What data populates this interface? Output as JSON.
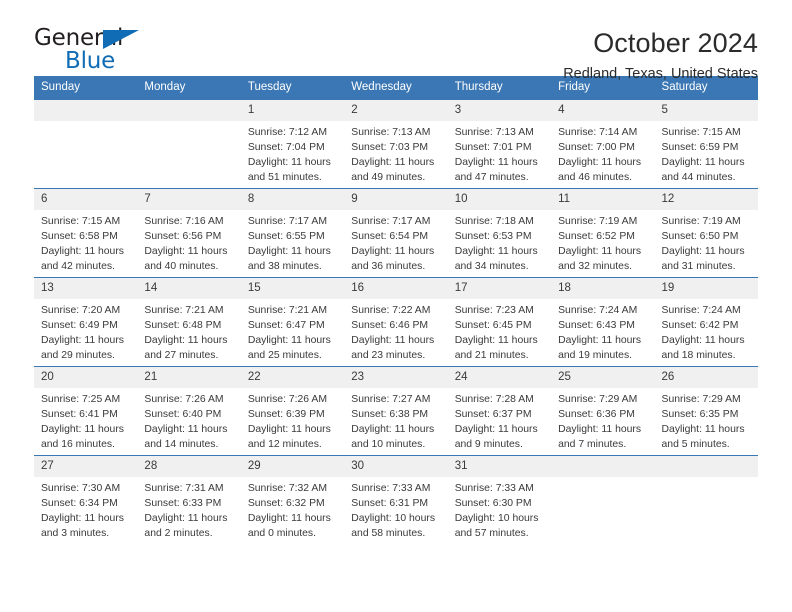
{
  "logo": {
    "word_one": "General",
    "word_two": "Blue",
    "triangle": "blue-triangle",
    "accent_dark": "#231f20",
    "accent_blue": "#0f6cb5"
  },
  "header": {
    "title": "October 2024",
    "subtitle": "Redland, Texas, United States"
  },
  "theme": {
    "header_blue": "#3b77b4",
    "daynum_band": "#f0f0f0",
    "text": "#3a3a3a"
  },
  "weekday_headers": [
    "Sunday",
    "Monday",
    "Tuesday",
    "Wednesday",
    "Thursday",
    "Friday",
    "Saturday"
  ],
  "weeks": [
    [
      {
        "day": "",
        "sunrise": "",
        "sunset": "",
        "daylight_line1": "",
        "daylight_line2": "",
        "empty": true
      },
      {
        "day": "",
        "sunrise": "",
        "sunset": "",
        "daylight_line1": "",
        "daylight_line2": "",
        "empty": true
      },
      {
        "day": "1",
        "sunrise": "Sunrise: 7:12 AM",
        "sunset": "Sunset: 7:04 PM",
        "daylight_line1": "Daylight: 11 hours",
        "daylight_line2": "and 51 minutes."
      },
      {
        "day": "2",
        "sunrise": "Sunrise: 7:13 AM",
        "sunset": "Sunset: 7:03 PM",
        "daylight_line1": "Daylight: 11 hours",
        "daylight_line2": "and 49 minutes."
      },
      {
        "day": "3",
        "sunrise": "Sunrise: 7:13 AM",
        "sunset": "Sunset: 7:01 PM",
        "daylight_line1": "Daylight: 11 hours",
        "daylight_line2": "and 47 minutes."
      },
      {
        "day": "4",
        "sunrise": "Sunrise: 7:14 AM",
        "sunset": "Sunset: 7:00 PM",
        "daylight_line1": "Daylight: 11 hours",
        "daylight_line2": "and 46 minutes."
      },
      {
        "day": "5",
        "sunrise": "Sunrise: 7:15 AM",
        "sunset": "Sunset: 6:59 PM",
        "daylight_line1": "Daylight: 11 hours",
        "daylight_line2": "and 44 minutes."
      }
    ],
    [
      {
        "day": "6",
        "sunrise": "Sunrise: 7:15 AM",
        "sunset": "Sunset: 6:58 PM",
        "daylight_line1": "Daylight: 11 hours",
        "daylight_line2": "and 42 minutes."
      },
      {
        "day": "7",
        "sunrise": "Sunrise: 7:16 AM",
        "sunset": "Sunset: 6:56 PM",
        "daylight_line1": "Daylight: 11 hours",
        "daylight_line2": "and 40 minutes."
      },
      {
        "day": "8",
        "sunrise": "Sunrise: 7:17 AM",
        "sunset": "Sunset: 6:55 PM",
        "daylight_line1": "Daylight: 11 hours",
        "daylight_line2": "and 38 minutes."
      },
      {
        "day": "9",
        "sunrise": "Sunrise: 7:17 AM",
        "sunset": "Sunset: 6:54 PM",
        "daylight_line1": "Daylight: 11 hours",
        "daylight_line2": "and 36 minutes."
      },
      {
        "day": "10",
        "sunrise": "Sunrise: 7:18 AM",
        "sunset": "Sunset: 6:53 PM",
        "daylight_line1": "Daylight: 11 hours",
        "daylight_line2": "and 34 minutes."
      },
      {
        "day": "11",
        "sunrise": "Sunrise: 7:19 AM",
        "sunset": "Sunset: 6:52 PM",
        "daylight_line1": "Daylight: 11 hours",
        "daylight_line2": "and 32 minutes."
      },
      {
        "day": "12",
        "sunrise": "Sunrise: 7:19 AM",
        "sunset": "Sunset: 6:50 PM",
        "daylight_line1": "Daylight: 11 hours",
        "daylight_line2": "and 31 minutes."
      }
    ],
    [
      {
        "day": "13",
        "sunrise": "Sunrise: 7:20 AM",
        "sunset": "Sunset: 6:49 PM",
        "daylight_line1": "Daylight: 11 hours",
        "daylight_line2": "and 29 minutes."
      },
      {
        "day": "14",
        "sunrise": "Sunrise: 7:21 AM",
        "sunset": "Sunset: 6:48 PM",
        "daylight_line1": "Daylight: 11 hours",
        "daylight_line2": "and 27 minutes."
      },
      {
        "day": "15",
        "sunrise": "Sunrise: 7:21 AM",
        "sunset": "Sunset: 6:47 PM",
        "daylight_line1": "Daylight: 11 hours",
        "daylight_line2": "and 25 minutes."
      },
      {
        "day": "16",
        "sunrise": "Sunrise: 7:22 AM",
        "sunset": "Sunset: 6:46 PM",
        "daylight_line1": "Daylight: 11 hours",
        "daylight_line2": "and 23 minutes."
      },
      {
        "day": "17",
        "sunrise": "Sunrise: 7:23 AM",
        "sunset": "Sunset: 6:45 PM",
        "daylight_line1": "Daylight: 11 hours",
        "daylight_line2": "and 21 minutes."
      },
      {
        "day": "18",
        "sunrise": "Sunrise: 7:24 AM",
        "sunset": "Sunset: 6:43 PM",
        "daylight_line1": "Daylight: 11 hours",
        "daylight_line2": "and 19 minutes."
      },
      {
        "day": "19",
        "sunrise": "Sunrise: 7:24 AM",
        "sunset": "Sunset: 6:42 PM",
        "daylight_line1": "Daylight: 11 hours",
        "daylight_line2": "and 18 minutes."
      }
    ],
    [
      {
        "day": "20",
        "sunrise": "Sunrise: 7:25 AM",
        "sunset": "Sunset: 6:41 PM",
        "daylight_line1": "Daylight: 11 hours",
        "daylight_line2": "and 16 minutes."
      },
      {
        "day": "21",
        "sunrise": "Sunrise: 7:26 AM",
        "sunset": "Sunset: 6:40 PM",
        "daylight_line1": "Daylight: 11 hours",
        "daylight_line2": "and 14 minutes."
      },
      {
        "day": "22",
        "sunrise": "Sunrise: 7:26 AM",
        "sunset": "Sunset: 6:39 PM",
        "daylight_line1": "Daylight: 11 hours",
        "daylight_line2": "and 12 minutes."
      },
      {
        "day": "23",
        "sunrise": "Sunrise: 7:27 AM",
        "sunset": "Sunset: 6:38 PM",
        "daylight_line1": "Daylight: 11 hours",
        "daylight_line2": "and 10 minutes."
      },
      {
        "day": "24",
        "sunrise": "Sunrise: 7:28 AM",
        "sunset": "Sunset: 6:37 PM",
        "daylight_line1": "Daylight: 11 hours",
        "daylight_line2": "and 9 minutes."
      },
      {
        "day": "25",
        "sunrise": "Sunrise: 7:29 AM",
        "sunset": "Sunset: 6:36 PM",
        "daylight_line1": "Daylight: 11 hours",
        "daylight_line2": "and 7 minutes."
      },
      {
        "day": "26",
        "sunrise": "Sunrise: 7:29 AM",
        "sunset": "Sunset: 6:35 PM",
        "daylight_line1": "Daylight: 11 hours",
        "daylight_line2": "and 5 minutes."
      }
    ],
    [
      {
        "day": "27",
        "sunrise": "Sunrise: 7:30 AM",
        "sunset": "Sunset: 6:34 PM",
        "daylight_line1": "Daylight: 11 hours",
        "daylight_line2": "and 3 minutes."
      },
      {
        "day": "28",
        "sunrise": "Sunrise: 7:31 AM",
        "sunset": "Sunset: 6:33 PM",
        "daylight_line1": "Daylight: 11 hours",
        "daylight_line2": "and 2 minutes."
      },
      {
        "day": "29",
        "sunrise": "Sunrise: 7:32 AM",
        "sunset": "Sunset: 6:32 PM",
        "daylight_line1": "Daylight: 11 hours",
        "daylight_line2": "and 0 minutes."
      },
      {
        "day": "30",
        "sunrise": "Sunrise: 7:33 AM",
        "sunset": "Sunset: 6:31 PM",
        "daylight_line1": "Daylight: 10 hours",
        "daylight_line2": "and 58 minutes."
      },
      {
        "day": "31",
        "sunrise": "Sunrise: 7:33 AM",
        "sunset": "Sunset: 6:30 PM",
        "daylight_line1": "Daylight: 10 hours",
        "daylight_line2": "and 57 minutes."
      },
      {
        "day": "",
        "sunrise": "",
        "sunset": "",
        "daylight_line1": "",
        "daylight_line2": "",
        "empty": true
      },
      {
        "day": "",
        "sunrise": "",
        "sunset": "",
        "daylight_line1": "",
        "daylight_line2": "",
        "empty": true
      }
    ]
  ]
}
